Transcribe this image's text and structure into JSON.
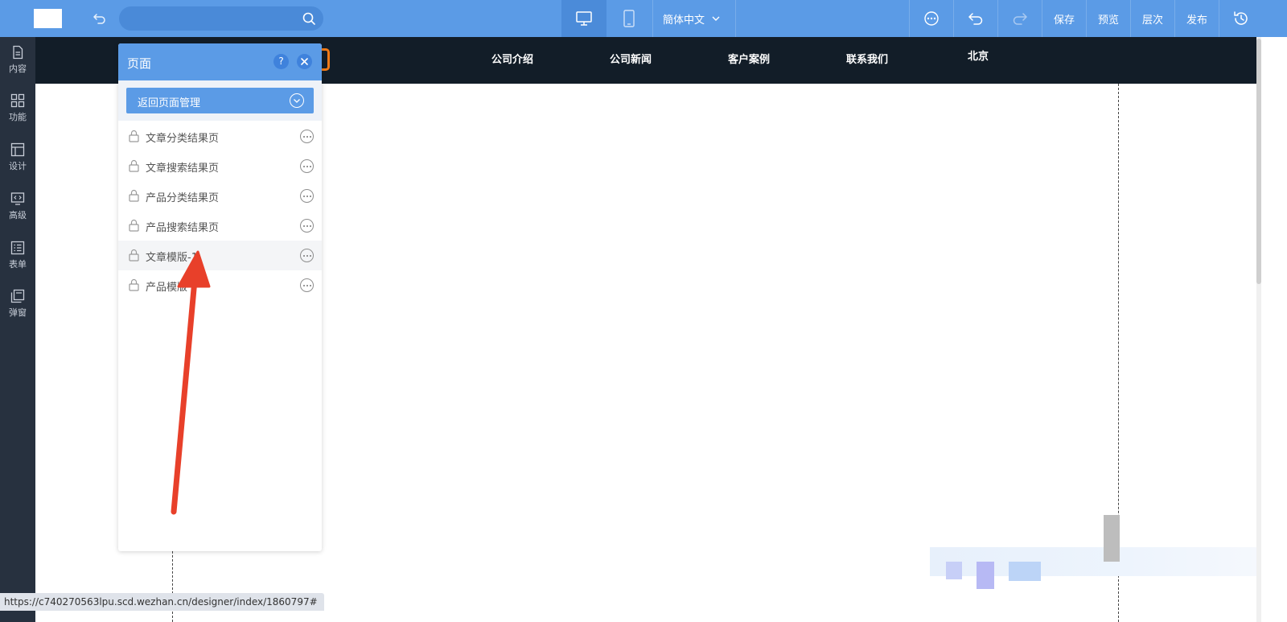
{
  "toolbar": {
    "language": "簡体中文",
    "search_placeholder": "",
    "buttons": {
      "save": "保存",
      "preview": "预览",
      "layers": "层次",
      "publish": "发布"
    }
  },
  "sidebar": {
    "items": [
      {
        "label": "内容",
        "icon": "document-icon"
      },
      {
        "label": "功能",
        "icon": "grid-icon"
      },
      {
        "label": "设计",
        "icon": "layout-icon"
      },
      {
        "label": "高级",
        "icon": "code-monitor-icon"
      },
      {
        "label": "表单",
        "icon": "list-icon"
      },
      {
        "label": "弹窗",
        "icon": "popup-icon"
      }
    ]
  },
  "site_nav": {
    "items": [
      "公司介绍",
      "公司新闻",
      "客户案例",
      "联系我们",
      "北京"
    ]
  },
  "panel": {
    "title": "页面",
    "help_symbol": "?",
    "back_button": "返回页面管理",
    "pages": [
      {
        "name": "文章分类结果页",
        "locked": true
      },
      {
        "name": "文章搜索结果页",
        "locked": true
      },
      {
        "name": "产品分类结果页",
        "locked": true
      },
      {
        "name": "产品搜索结果页",
        "locked": true
      },
      {
        "name": "文章模版-1",
        "locked": true,
        "highlighted": true
      },
      {
        "name": "产品模版",
        "locked": true
      }
    ]
  },
  "status_bar": {
    "url": "https://c740270563lpu.scd.wezhan.cn/designer/index/1860797#"
  },
  "colors": {
    "toolbar": "#5b9be6",
    "sidebar": "#27313f",
    "site_header": "#121d28",
    "annotation_arrow": "#e8402a",
    "logo_accent": "#f07a18"
  }
}
